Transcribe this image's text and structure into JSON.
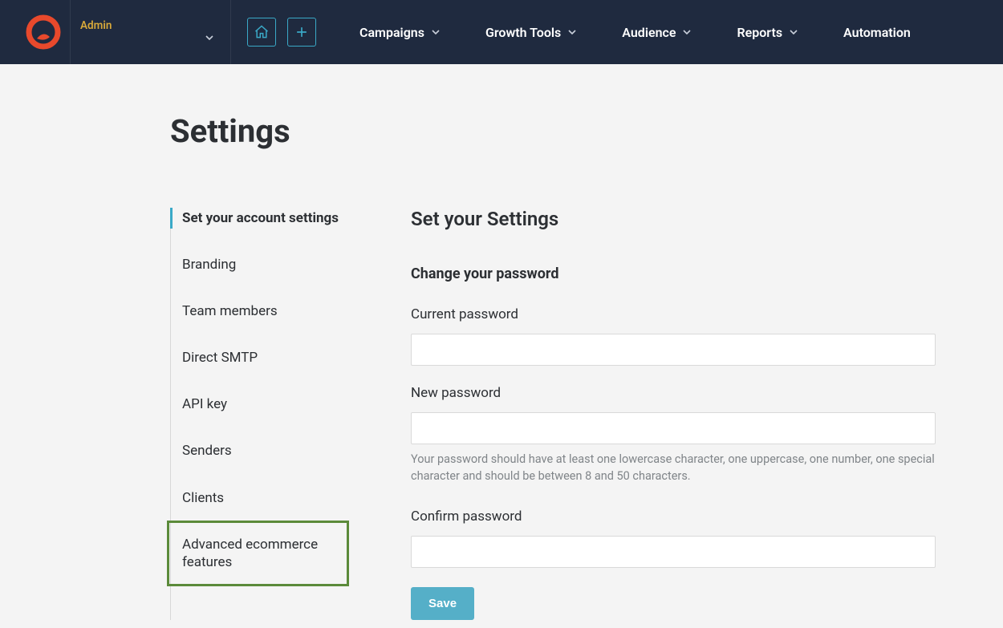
{
  "header": {
    "admin_label": "Admin",
    "nav": [
      {
        "label": "Campaigns",
        "has_caret": true
      },
      {
        "label": "Growth Tools",
        "has_caret": true
      },
      {
        "label": "Audience",
        "has_caret": true
      },
      {
        "label": "Reports",
        "has_caret": true
      },
      {
        "label": "Automation",
        "has_caret": false
      }
    ]
  },
  "page": {
    "title": "Settings"
  },
  "sidebar": {
    "items": [
      {
        "label": "Set your account settings",
        "active": true
      },
      {
        "label": "Branding"
      },
      {
        "label": "Team members"
      },
      {
        "label": "Direct SMTP"
      },
      {
        "label": "API key"
      },
      {
        "label": "Senders"
      },
      {
        "label": "Clients"
      },
      {
        "label": "Advanced ecommerce features",
        "highlighted": true
      }
    ]
  },
  "main": {
    "section_title": "Set your Settings",
    "subsection_title": "Change your password",
    "fields": {
      "current_password_label": "Current password",
      "new_password_label": "New password",
      "new_password_hint": "Your password should have at least one lowercase character, one uppercase, one number, one special character and should be between 8 and 50 characters.",
      "confirm_password_label": "Confirm password"
    },
    "save_label": "Save"
  }
}
